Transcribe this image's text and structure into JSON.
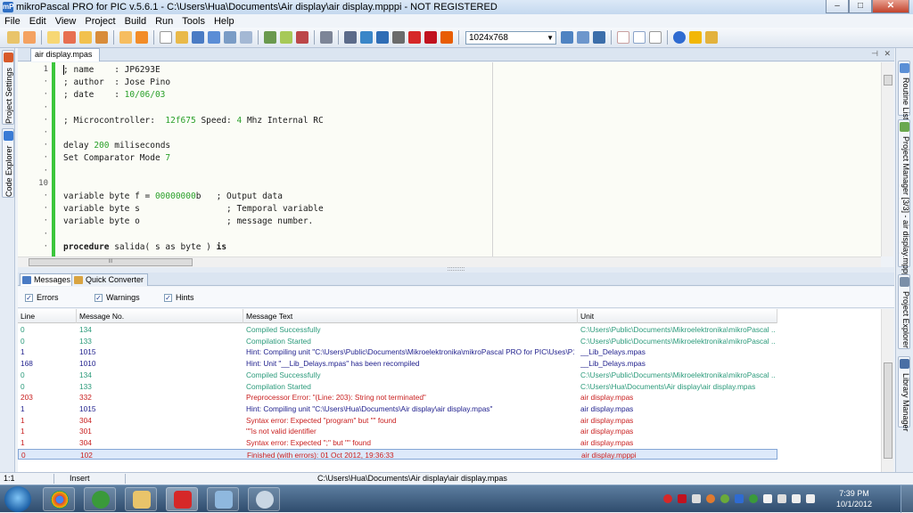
{
  "window": {
    "title": "mikroPascal PRO for PIC v.5.6.1 - C:\\Users\\Hua\\Documents\\Air display\\air display.mpppi - NOT REGISTERED",
    "app_icon": "mP",
    "controls": {
      "minimize": "–",
      "maximize": "□",
      "close": "✕"
    }
  },
  "menu": [
    "File",
    "Edit",
    "View",
    "Project",
    "Build",
    "Run",
    "Tools",
    "Help"
  ],
  "toolbar": {
    "resolution": "1024x768"
  },
  "left_panels": [
    "Project Settings",
    "Code Explorer"
  ],
  "right_panels": [
    "Routine List",
    "Project Manager [3/3] - air display.mpppi",
    "Project Explorer",
    "Library Manager"
  ],
  "editor": {
    "tab": "air display.mpas",
    "pin": "⊣",
    "close": "✕",
    "lines": [
      {
        "num": "1",
        "parts": [
          {
            "t": "; name    : JP6293E"
          }
        ]
      },
      {
        "num": "·",
        "parts": [
          {
            "t": "; author  : Jose Pino"
          }
        ]
      },
      {
        "num": "·",
        "parts": [
          {
            "t": "; date    : "
          },
          {
            "t": "10/06/03",
            "c": "n"
          }
        ]
      },
      {
        "num": "·",
        "parts": [
          {
            "t": ""
          }
        ]
      },
      {
        "num": "·",
        "parts": [
          {
            "t": "; Microcontroller:  "
          },
          {
            "t": "12f675",
            "c": "n"
          },
          {
            "t": " Speed: "
          },
          {
            "t": "4",
            "c": "n"
          },
          {
            "t": " Mhz Internal RC"
          }
        ]
      },
      {
        "num": "·",
        "parts": [
          {
            "t": ""
          }
        ]
      },
      {
        "num": "·",
        "parts": [
          {
            "t": "delay "
          },
          {
            "t": "200",
            "c": "n"
          },
          {
            "t": " miliseconds"
          }
        ]
      },
      {
        "num": "·",
        "parts": [
          {
            "t": "Set Comparator Mode "
          },
          {
            "t": "7",
            "c": "n"
          }
        ]
      },
      {
        "num": "·",
        "parts": [
          {
            "t": ""
          }
        ]
      },
      {
        "num": "10",
        "parts": [
          {
            "t": ""
          }
        ]
      },
      {
        "num": "·",
        "parts": [
          {
            "t": "variable byte f = "
          },
          {
            "t": "00000000",
            "c": "n"
          },
          {
            "t": "b   ; Output data"
          }
        ]
      },
      {
        "num": "·",
        "parts": [
          {
            "t": "variable byte s                 ; Temporal variable"
          }
        ]
      },
      {
        "num": "·",
        "parts": [
          {
            "t": "variable byte o                 ; message number."
          }
        ]
      },
      {
        "num": "·",
        "parts": [
          {
            "t": ""
          }
        ]
      },
      {
        "num": "·",
        "parts": [
          {
            "t": "procedure",
            "c": "k"
          },
          {
            "t": " salida( s as byte ) "
          },
          {
            "t": "is",
            "c": "k"
          }
        ]
      }
    ],
    "hscroll_grip": "III"
  },
  "splitter_grip": "::::::::::",
  "messages": {
    "tabs": [
      "Messages",
      "Quick Converter"
    ],
    "filters": [
      {
        "label": "Errors",
        "checked": "✓"
      },
      {
        "label": "Warnings",
        "checked": "✓"
      },
      {
        "label": "Hints",
        "checked": "✓"
      }
    ],
    "columns": [
      "Line",
      "Message No.",
      "Message Text",
      "Unit"
    ],
    "rows": [
      {
        "line": "0",
        "no": "134",
        "text": "Compiled Successfully",
        "unit": "C:\\Users\\Public\\Documents\\Mikroelektronika\\mikroPascal ...",
        "kind": "ok"
      },
      {
        "line": "0",
        "no": "133",
        "text": "Compilation Started",
        "unit": "C:\\Users\\Public\\Documents\\Mikroelektronika\\mikroPascal ...",
        "kind": "ok"
      },
      {
        "line": "1",
        "no": "1015",
        "text": "Hint: Compiling unit \"C:\\Users\\Public\\Documents\\Mikroelektronika\\mikroPascal PRO for PIC\\Uses\\P1...",
        "unit": "__Lib_Delays.mpas",
        "kind": "hint"
      },
      {
        "line": "168",
        "no": "1010",
        "text": "Hint: Unit \"__Lib_Delays.mpas\" has been recompiled",
        "unit": "__Lib_Delays.mpas",
        "kind": "hint"
      },
      {
        "line": "0",
        "no": "134",
        "text": "Compiled Successfully",
        "unit": "C:\\Users\\Public\\Documents\\Mikroelektronika\\mikroPascal ...",
        "kind": "ok"
      },
      {
        "line": "0",
        "no": "133",
        "text": "Compilation Started",
        "unit": "C:\\Users\\Hua\\Documents\\Air display\\air display.mpas",
        "kind": "ok"
      },
      {
        "line": "203",
        "no": "332",
        "text": "Preprocessor Error: \"(Line: 203): String not terminated\"",
        "unit": "air display.mpas",
        "kind": "err"
      },
      {
        "line": "1",
        "no": "1015",
        "text": "Hint: Compiling unit \"C:\\Users\\Hua\\Documents\\Air display\\air display.mpas\"",
        "unit": "air display.mpas",
        "kind": "hint"
      },
      {
        "line": "1",
        "no": "304",
        "text": "Syntax error: Expected \"program\" but \"\" found",
        "unit": "air display.mpas",
        "kind": "err"
      },
      {
        "line": "1",
        "no": "301",
        "text": "\"\"is not valid identifier",
        "unit": "air display.mpas",
        "kind": "err"
      },
      {
        "line": "1",
        "no": "304",
        "text": "Syntax error: Expected \";\" but \"\" found",
        "unit": "air display.mpas",
        "kind": "err"
      },
      {
        "line": "0",
        "no": "102",
        "text": "Finished (with errors): 01 Oct 2012, 19:36:33",
        "unit": "air display.mpppi",
        "kind": "err"
      }
    ]
  },
  "statusbar": {
    "position": "1:1",
    "mode": "Insert",
    "path": "C:\\Users\\Hua\\Documents\\Air display\\air display.mpas"
  },
  "taskbar": {
    "time": "7:39 PM",
    "date": "10/1/2012"
  },
  "colors": {
    "ok": "#2a9a7a",
    "hint": "#1e1e8c",
    "err": "#c81e1e",
    "number": "#2aa02a"
  }
}
